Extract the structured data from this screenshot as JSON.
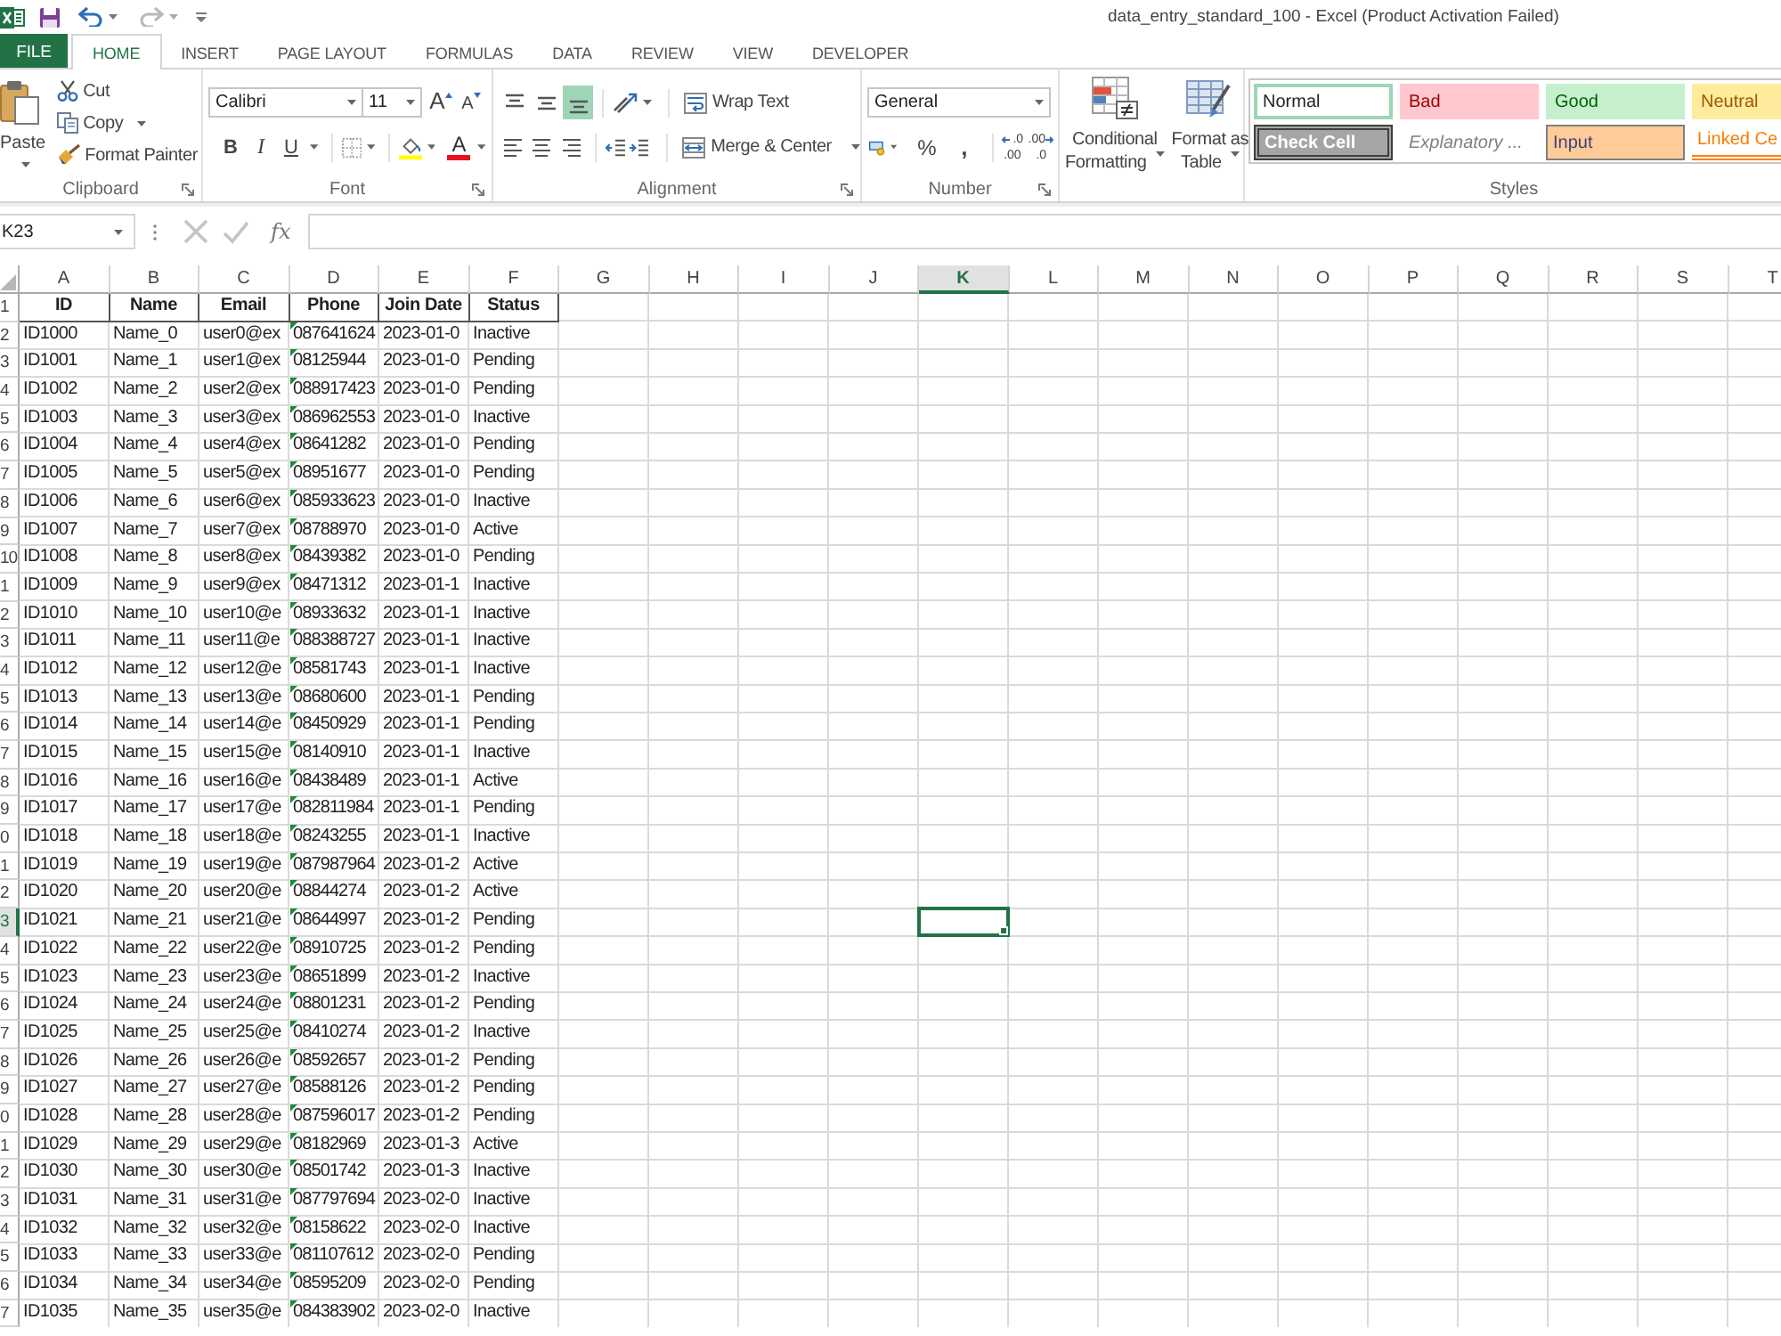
{
  "quick_access": [
    {
      "kind": "save",
      "disabled": false
    },
    {
      "kind": "undo",
      "disabled": false
    },
    {
      "kind": "redo",
      "disabled": true
    },
    {
      "kind": "customize",
      "disabled": false
    }
  ],
  "window": {
    "title": "data_entry_standard_100 - Excel (Product Activation Failed)"
  },
  "tabs": [
    {
      "label": "FILE",
      "kind": "backstage",
      "selected": false
    },
    {
      "label": "HOME",
      "kind": "tab",
      "selected": true
    },
    {
      "label": "INSERT",
      "kind": "tab",
      "selected": false
    },
    {
      "label": "PAGE LAYOUT",
      "kind": "tab",
      "selected": false
    },
    {
      "label": "FORMULAS",
      "kind": "tab",
      "selected": false
    },
    {
      "label": "DATA",
      "kind": "tab",
      "selected": false
    },
    {
      "label": "REVIEW",
      "kind": "tab",
      "selected": false
    },
    {
      "label": "VIEW",
      "kind": "tab",
      "selected": false
    },
    {
      "label": "DEVELOPER",
      "kind": "tab",
      "selected": false
    }
  ],
  "ribbon": {
    "clipboard": {
      "label": "Clipboard",
      "paste": "Paste",
      "cut": "Cut",
      "copy": "Copy",
      "format_painter": "Format Painter"
    },
    "font": {
      "label": "Font",
      "font_name": "Calibri",
      "font_size": "11",
      "grow": "A",
      "shrink": "A",
      "bold": "B",
      "italic": "I",
      "underline": "U",
      "font_color": "A"
    },
    "alignment": {
      "label": "Alignment",
      "vertical": [
        {
          "kind": "top",
          "selected": false
        },
        {
          "kind": "middle",
          "selected": false
        },
        {
          "kind": "bottom",
          "selected": true
        }
      ],
      "horizontal": [
        {
          "kind": "left",
          "selected": false
        },
        {
          "kind": "center",
          "selected": false
        },
        {
          "kind": "right",
          "selected": false
        }
      ],
      "wrap_text": "Wrap Text",
      "merge": "Merge & Center"
    },
    "number": {
      "label": "Number",
      "format": "General",
      "percent": "%",
      "comma": ",",
      "increase_decimal": [
        ".0",
        ".00"
      ],
      "decrease_decimal": [
        ".00",
        ".0"
      ]
    },
    "tables": {
      "conditional": [
        "Conditional",
        "Formatting"
      ],
      "format_table": [
        "Format as",
        "Table"
      ]
    },
    "styles": {
      "label": "Styles",
      "items": [
        {
          "label": "Normal",
          "kind": "normal",
          "selected": true
        },
        {
          "label": "Bad",
          "kind": "bad",
          "selected": false
        },
        {
          "label": "Good",
          "kind": "good",
          "selected": false
        },
        {
          "label": "Neutral",
          "kind": "neutral",
          "selected": false
        },
        {
          "label": "Check Cell",
          "kind": "check",
          "selected": false
        },
        {
          "label": "Explanatory ...",
          "kind": "explanatory",
          "selected": false
        },
        {
          "label": "Input",
          "kind": "input",
          "selected": false
        },
        {
          "label": "Linked Ce",
          "kind": "linked",
          "selected": false
        }
      ]
    }
  },
  "formula_bar": {
    "name_box": "K23",
    "function_label": "fx"
  },
  "sheet": {
    "columns": [
      {
        "label": "A",
        "selected": false
      },
      {
        "label": "B",
        "selected": false
      },
      {
        "label": "C",
        "selected": false
      },
      {
        "label": "D",
        "selected": false
      },
      {
        "label": "E",
        "selected": false
      },
      {
        "label": "F",
        "selected": false
      },
      {
        "label": "G",
        "selected": false
      },
      {
        "label": "H",
        "selected": false
      },
      {
        "label": "I",
        "selected": false
      },
      {
        "label": "J",
        "selected": false
      },
      {
        "label": "K",
        "selected": true
      },
      {
        "label": "L",
        "selected": false
      },
      {
        "label": "M",
        "selected": false
      },
      {
        "label": "N",
        "selected": false
      },
      {
        "label": "O",
        "selected": false
      },
      {
        "label": "P",
        "selected": false
      },
      {
        "label": "Q",
        "selected": false
      },
      {
        "label": "R",
        "selected": false
      },
      {
        "label": "S",
        "selected": false
      },
      {
        "label": "T",
        "selected": false
      }
    ],
    "rows": [
      {
        "number": "1",
        "selected": false,
        "kind": "header",
        "warning": false,
        "cells": [
          "ID",
          "Name",
          "Email",
          "Phone",
          "Join Date",
          "Status"
        ]
      },
      {
        "number": "2",
        "selected": false,
        "kind": "data",
        "warning": true,
        "cells": [
          "ID1000",
          "Name_0",
          "user0@ex",
          "087641624",
          "2023-01-0",
          "Inactive"
        ]
      },
      {
        "number": "3",
        "selected": false,
        "kind": "data",
        "warning": true,
        "cells": [
          "ID1001",
          "Name_1",
          "user1@ex",
          "08125944",
          "2023-01-0",
          "Pending"
        ]
      },
      {
        "number": "4",
        "selected": false,
        "kind": "data",
        "warning": true,
        "cells": [
          "ID1002",
          "Name_2",
          "user2@ex",
          "088917423",
          "2023-01-0",
          "Pending"
        ]
      },
      {
        "number": "5",
        "selected": false,
        "kind": "data",
        "warning": true,
        "cells": [
          "ID1003",
          "Name_3",
          "user3@ex",
          "086962553",
          "2023-01-0",
          "Inactive"
        ]
      },
      {
        "number": "6",
        "selected": false,
        "kind": "data",
        "warning": true,
        "cells": [
          "ID1004",
          "Name_4",
          "user4@ex",
          "08641282",
          "2023-01-0",
          "Pending"
        ]
      },
      {
        "number": "7",
        "selected": false,
        "kind": "data",
        "warning": true,
        "cells": [
          "ID1005",
          "Name_5",
          "user5@ex",
          "08951677",
          "2023-01-0",
          "Pending"
        ]
      },
      {
        "number": "8",
        "selected": false,
        "kind": "data",
        "warning": true,
        "cells": [
          "ID1006",
          "Name_6",
          "user6@ex",
          "085933623",
          "2023-01-0",
          "Inactive"
        ]
      },
      {
        "number": "9",
        "selected": false,
        "kind": "data",
        "warning": true,
        "cells": [
          "ID1007",
          "Name_7",
          "user7@ex",
          "08788970",
          "2023-01-0",
          "Active"
        ]
      },
      {
        "number": "10",
        "selected": false,
        "kind": "data",
        "warning": true,
        "cells": [
          "ID1008",
          "Name_8",
          "user8@ex",
          "08439382",
          "2023-01-0",
          "Pending"
        ]
      },
      {
        "number": "1",
        "selected": false,
        "kind": "data",
        "warning": true,
        "cells": [
          "ID1009",
          "Name_9",
          "user9@ex",
          "08471312",
          "2023-01-1",
          "Inactive"
        ]
      },
      {
        "number": "2",
        "selected": false,
        "kind": "data",
        "warning": true,
        "cells": [
          "ID1010",
          "Name_10",
          "user10@e",
          "08933632",
          "2023-01-1",
          "Inactive"
        ]
      },
      {
        "number": "3",
        "selected": false,
        "kind": "data",
        "warning": true,
        "cells": [
          "ID1011",
          "Name_11",
          "user11@e",
          "088388727",
          "2023-01-1",
          "Inactive"
        ]
      },
      {
        "number": "4",
        "selected": false,
        "kind": "data",
        "warning": true,
        "cells": [
          "ID1012",
          "Name_12",
          "user12@e",
          "08581743",
          "2023-01-1",
          "Inactive"
        ]
      },
      {
        "number": "5",
        "selected": false,
        "kind": "data",
        "warning": true,
        "cells": [
          "ID1013",
          "Name_13",
          "user13@e",
          "08680600",
          "2023-01-1",
          "Pending"
        ]
      },
      {
        "number": "6",
        "selected": false,
        "kind": "data",
        "warning": true,
        "cells": [
          "ID1014",
          "Name_14",
          "user14@e",
          "08450929",
          "2023-01-1",
          "Pending"
        ]
      },
      {
        "number": "7",
        "selected": false,
        "kind": "data",
        "warning": true,
        "cells": [
          "ID1015",
          "Name_15",
          "user15@e",
          "08140910",
          "2023-01-1",
          "Inactive"
        ]
      },
      {
        "number": "8",
        "selected": false,
        "kind": "data",
        "warning": true,
        "cells": [
          "ID1016",
          "Name_16",
          "user16@e",
          "08438489",
          "2023-01-1",
          "Active"
        ]
      },
      {
        "number": "9",
        "selected": false,
        "kind": "data",
        "warning": true,
        "cells": [
          "ID1017",
          "Name_17",
          "user17@e",
          "082811984",
          "2023-01-1",
          "Pending"
        ]
      },
      {
        "number": "0",
        "selected": false,
        "kind": "data",
        "warning": true,
        "cells": [
          "ID1018",
          "Name_18",
          "user18@e",
          "08243255",
          "2023-01-1",
          "Inactive"
        ]
      },
      {
        "number": "1",
        "selected": false,
        "kind": "data",
        "warning": true,
        "cells": [
          "ID1019",
          "Name_19",
          "user19@e",
          "087987964",
          "2023-01-2",
          "Active"
        ]
      },
      {
        "number": "2",
        "selected": false,
        "kind": "data",
        "warning": true,
        "cells": [
          "ID1020",
          "Name_20",
          "user20@e",
          "08844274",
          "2023-01-2",
          "Active"
        ]
      },
      {
        "number": "3",
        "selected": true,
        "kind": "data",
        "warning": true,
        "cells": [
          "ID1021",
          "Name_21",
          "user21@e",
          "08644997",
          "2023-01-2",
          "Pending"
        ]
      },
      {
        "number": "4",
        "selected": false,
        "kind": "data",
        "warning": true,
        "cells": [
          "ID1022",
          "Name_22",
          "user22@e",
          "08910725",
          "2023-01-2",
          "Pending"
        ]
      },
      {
        "number": "5",
        "selected": false,
        "kind": "data",
        "warning": true,
        "cells": [
          "ID1023",
          "Name_23",
          "user23@e",
          "08651899",
          "2023-01-2",
          "Inactive"
        ]
      },
      {
        "number": "6",
        "selected": false,
        "kind": "data",
        "warning": true,
        "cells": [
          "ID1024",
          "Name_24",
          "user24@e",
          "08801231",
          "2023-01-2",
          "Pending"
        ]
      },
      {
        "number": "7",
        "selected": false,
        "kind": "data",
        "warning": true,
        "cells": [
          "ID1025",
          "Name_25",
          "user25@e",
          "08410274",
          "2023-01-2",
          "Inactive"
        ]
      },
      {
        "number": "8",
        "selected": false,
        "kind": "data",
        "warning": true,
        "cells": [
          "ID1026",
          "Name_26",
          "user26@e",
          "08592657",
          "2023-01-2",
          "Pending"
        ]
      },
      {
        "number": "9",
        "selected": false,
        "kind": "data",
        "warning": true,
        "cells": [
          "ID1027",
          "Name_27",
          "user27@e",
          "08588126",
          "2023-01-2",
          "Pending"
        ]
      },
      {
        "number": "0",
        "selected": false,
        "kind": "data",
        "warning": true,
        "cells": [
          "ID1028",
          "Name_28",
          "user28@e",
          "087596017",
          "2023-01-2",
          "Pending"
        ]
      },
      {
        "number": "1",
        "selected": false,
        "kind": "data",
        "warning": true,
        "cells": [
          "ID1029",
          "Name_29",
          "user29@e",
          "08182969",
          "2023-01-3",
          "Active"
        ]
      },
      {
        "number": "2",
        "selected": false,
        "kind": "data",
        "warning": true,
        "cells": [
          "ID1030",
          "Name_30",
          "user30@e",
          "08501742",
          "2023-01-3",
          "Inactive"
        ]
      },
      {
        "number": "3",
        "selected": false,
        "kind": "data",
        "warning": true,
        "cells": [
          "ID1031",
          "Name_31",
          "user31@e",
          "087797694",
          "2023-02-0",
          "Inactive"
        ]
      },
      {
        "number": "4",
        "selected": false,
        "kind": "data",
        "warning": true,
        "cells": [
          "ID1032",
          "Name_32",
          "user32@e",
          "08158622",
          "2023-02-0",
          "Inactive"
        ]
      },
      {
        "number": "5",
        "selected": false,
        "kind": "data",
        "warning": true,
        "cells": [
          "ID1033",
          "Name_33",
          "user33@e",
          "081107612",
          "2023-02-0",
          "Pending"
        ]
      },
      {
        "number": "6",
        "selected": false,
        "kind": "data",
        "warning": true,
        "cells": [
          "ID1034",
          "Name_34",
          "user34@e",
          "08595209",
          "2023-02-0",
          "Pending"
        ]
      },
      {
        "number": "7",
        "selected": false,
        "kind": "data",
        "warning": true,
        "cells": [
          "ID1035",
          "Name_35",
          "user35@e",
          "084383902",
          "2023-02-0",
          "Inactive"
        ]
      }
    ]
  }
}
